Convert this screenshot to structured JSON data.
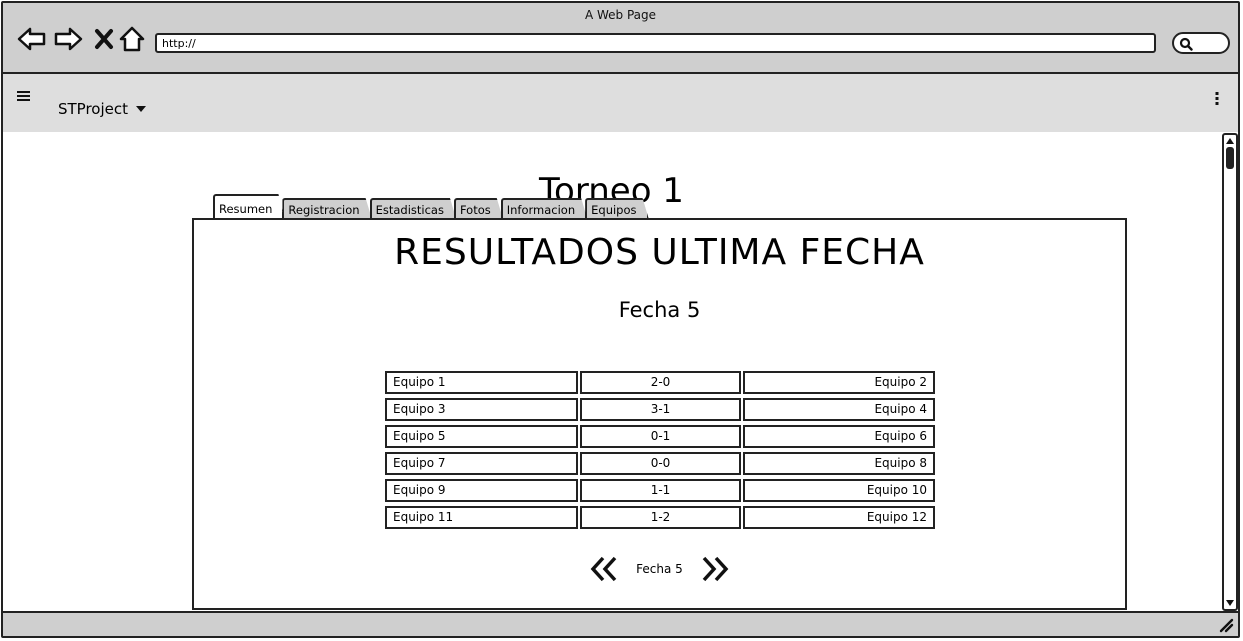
{
  "window": {
    "title": "A Web Page"
  },
  "browser": {
    "url": "http://",
    "icons": [
      "back-arrow-icon",
      "forward-arrow-icon",
      "close-x-icon",
      "home-icon",
      "search-icon"
    ]
  },
  "app": {
    "brand": "STProject",
    "icons": [
      "hamburger-menu-icon",
      "caret-down-icon",
      "kebab-menu-icon"
    ]
  },
  "page": {
    "title": "Torneo 1",
    "tabs": [
      {
        "label": "Resumen",
        "active": true
      },
      {
        "label": "Registracion",
        "active": false
      },
      {
        "label": "Estadisticas",
        "active": false
      },
      {
        "label": "Fotos",
        "active": false
      },
      {
        "label": "Informacion",
        "active": false
      },
      {
        "label": "Equipos",
        "active": false
      }
    ],
    "headline": "RESULTADOS ULTIMA FECHA",
    "subheading": "Fecha 5",
    "results": [
      {
        "home": "Equipo 1",
        "score": "2-0",
        "away": "Equipo 2"
      },
      {
        "home": "Equipo 3",
        "score": "3-1",
        "away": "Equipo 4"
      },
      {
        "home": "Equipo 5",
        "score": "0-1",
        "away": "Equipo 6"
      },
      {
        "home": "Equipo 7",
        "score": "0-0",
        "away": "Equipo 8"
      },
      {
        "home": "Equipo 9",
        "score": "1-1",
        "away": "Equipo 10"
      },
      {
        "home": "Equipo 11",
        "score": "1-2",
        "away": "Equipo 12"
      }
    ],
    "pager": {
      "label": "Fecha 5"
    }
  },
  "colors": {
    "chrome": "#cfcfcf",
    "header": "#dedede",
    "stroke": "#222222"
  }
}
